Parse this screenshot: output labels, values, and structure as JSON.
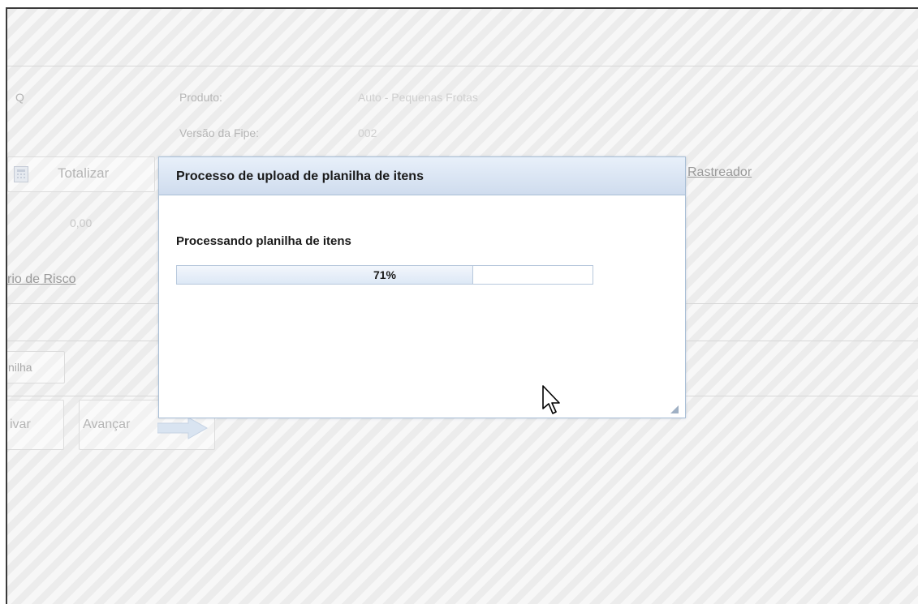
{
  "background": {
    "produto_label": "Produto:",
    "produto_value": "Auto - Pequenas Frotas",
    "versao_label": "Versão da Fipe:",
    "versao_value": "002",
    "left_fragment": "Q",
    "totalizar_label": "Totalizar",
    "total_value": "0,00",
    "rastreador_link": "Rastreador",
    "risco_link": "rio de Risco",
    "planilha_button": "nilha",
    "salvar_button": "ivar",
    "avancar_button": "Avançar"
  },
  "dialog": {
    "title": "Processo de upload de planilha de itens",
    "message": "Processando planilha de itens",
    "progress_label": "71%",
    "progress_fraction": 0.71
  },
  "colors": {
    "dialog_header": "#cfdcee",
    "dialog_border": "#a9bfd6",
    "progress_fill": "#dde8f6"
  },
  "icons": {
    "calculator": "calculator-icon",
    "arrow": "arrow-right-icon",
    "cursor": "mouse-pointer-icon",
    "grip": "resize-grip-icon"
  }
}
